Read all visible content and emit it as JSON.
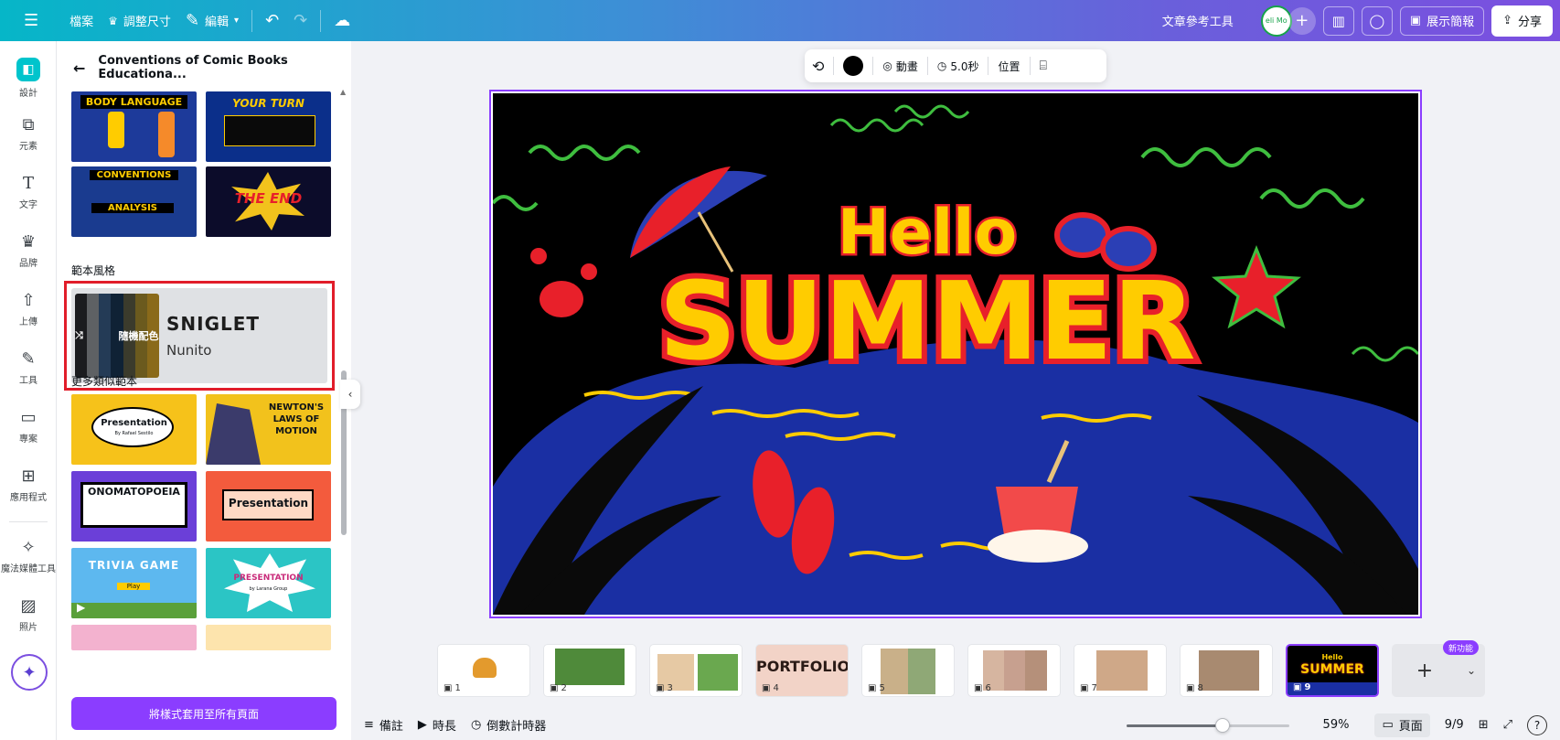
{
  "topbar": {
    "menu_icon": "menu-icon",
    "file_label": "檔案",
    "resize_label": "調整尺寸",
    "edit_label": "編輯",
    "ref_tool_label": "文章參考工具",
    "avatar_text": "eli Mo",
    "present_label": "展示簡報",
    "share_label": "分享"
  },
  "rail": {
    "items": [
      {
        "label": "設計",
        "icon": "design-icon"
      },
      {
        "label": "元素",
        "icon": "elements-icon"
      },
      {
        "label": "文字",
        "icon": "text-icon"
      },
      {
        "label": "品牌",
        "icon": "brand-icon"
      },
      {
        "label": "上傳",
        "icon": "upload-icon"
      },
      {
        "label": "工具",
        "icon": "tools-icon"
      },
      {
        "label": "專案",
        "icon": "projects-icon"
      },
      {
        "label": "應用程式",
        "icon": "apps-icon"
      },
      {
        "label": "魔法媒體工具",
        "icon": "magic-media-icon"
      },
      {
        "label": "照片",
        "icon": "photos-icon"
      }
    ]
  },
  "panel": {
    "title": "Conventions of Comic Books Educationa...",
    "template_thumbs": [
      {
        "text": "BODY LANGUAGE",
        "bg": "#1d3a9a"
      },
      {
        "text": "YOUR TURN",
        "bg": "#0b2f8a"
      },
      {
        "text": "CONVENTIONS",
        "bg": "#1a3b8f",
        "sub": "ANALYSIS"
      },
      {
        "text": "THE END",
        "bg": "#0c0c2a"
      }
    ],
    "style_section": "範本風格",
    "style": {
      "shuffle_label": "隨機配色",
      "heading_font": "SNIGLET",
      "body_font": "Nunito",
      "palette": [
        "#1b1c1f",
        "#5e6164",
        "#243b56",
        "#0f2235",
        "#3b3b2c",
        "#6b5a1e",
        "#8a6a1a"
      ]
    },
    "similar_section": "更多類似範本",
    "similar_thumbs": [
      {
        "text": "Presentation",
        "sub": "By Rafael Sestilo",
        "bg": "#f6c21a"
      },
      {
        "text": "NEWTON'S LAWS OF MOTION",
        "bg": "#f2c21c"
      },
      {
        "text": "ONOMATOPOEIA",
        "bg": "#6b3fd8"
      },
      {
        "text": "Presentation",
        "bg": "#f35b3d"
      },
      {
        "text": "TRIVIA GAME",
        "sub": "Play",
        "bg": "#5db8ef"
      },
      {
        "text": "PRESENTATION",
        "sub": "by Larana Group",
        "bg": "#2bc5c5"
      }
    ],
    "apply_label": "將樣式套用至所有頁面"
  },
  "float_toolbar": {
    "animate_label": "動畫",
    "duration_label": "5.0秒",
    "position_label": "位置"
  },
  "slide": {
    "hello": "Hello",
    "summer": "SUMMER",
    "colors": {
      "bg": "#000000",
      "sea": "#1a2fa3",
      "text_fill": "#ffcc00",
      "text_stroke": "#e8202a",
      "wave": "#3fbe3f"
    }
  },
  "filmstrip": {
    "pages": [
      {
        "num": "1"
      },
      {
        "num": "2"
      },
      {
        "num": "3"
      },
      {
        "num": "4",
        "text": "PORTFOLIO"
      },
      {
        "num": "5"
      },
      {
        "num": "6"
      },
      {
        "num": "7"
      },
      {
        "num": "8"
      },
      {
        "num": "9",
        "text": "SUMMER",
        "sub": "Hello"
      }
    ],
    "new_badge": "新功能"
  },
  "bottombar": {
    "notes_label": "備註",
    "duration_label": "時長",
    "timer_label": "倒數計時器",
    "zoom_percent": "59%",
    "zoom_value": 0.59,
    "page_label": "頁面",
    "page_count": "9/9"
  }
}
